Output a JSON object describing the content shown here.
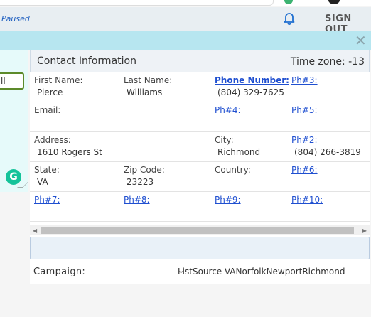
{
  "header": {
    "status": "Paused",
    "sign_out": "SIGN OUT"
  },
  "left": {
    "button_label": "ll"
  },
  "contact": {
    "title": "Contact Information",
    "timezone": "Time zone: -13",
    "first_name_label": "First Name:",
    "first_name": "Pierce",
    "last_name_label": "Last Name:",
    "last_name": "Williams",
    "phone_label": "Phone Number:",
    "phone": "(804) 329-7625",
    "ph3_label": "Ph#3:",
    "email_label": "Email:",
    "ph4_label": "Ph#4:",
    "ph5_label": "Ph#5:",
    "address_label": "Address:",
    "address": "1610 Rogers St",
    "city_label": "City:",
    "city": "Richmond",
    "ph2_label": "Ph#2:",
    "ph2": "(804) 266-3819",
    "state_label": "State:",
    "state": "VA",
    "zip_label": "Zip Code:",
    "zip": "23223",
    "country_label": "Country:",
    "ph6_label": "Ph#6:",
    "ph7_label": "Ph#7:",
    "ph8_label": "Ph#8:",
    "ph9_label": "Ph#9:",
    "ph10_label": "Ph#10:"
  },
  "campaign": {
    "label": "Campaign:",
    "selected": "ListSource-VANorfolkNewportRichmond"
  },
  "colors": {
    "accent_blue": "#1f4fd0",
    "header_bg": "#e8eef2",
    "cyan_bar": "#b7e6f0"
  }
}
